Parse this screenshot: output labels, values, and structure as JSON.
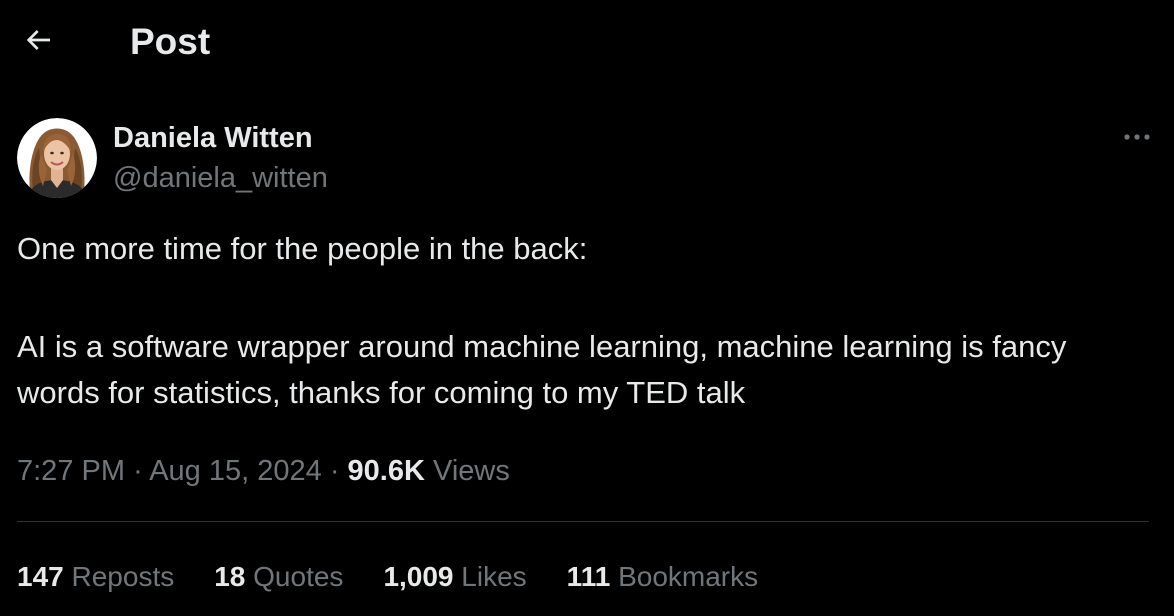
{
  "header": {
    "title": "Post",
    "back_icon": "arrow-left-icon"
  },
  "author": {
    "name": "Daniela Witten",
    "handle": "@daniela_witten",
    "avatar": "profile-photo"
  },
  "post": {
    "line1": "One more time for the people in the back:",
    "line2": "AI is a software wrapper around machine learning, machine learning is fancy words for statistics, thanks for coming to my TED talk"
  },
  "meta": {
    "time": "7:27 PM",
    "separator": "·",
    "date": "Aug 15, 2024",
    "views_count": "90.6K",
    "views_label": "Views"
  },
  "stats": [
    {
      "count": "147",
      "label": "Reposts"
    },
    {
      "count": "18",
      "label": "Quotes"
    },
    {
      "count": "1,009",
      "label": "Likes"
    },
    {
      "count": "111",
      "label": "Bookmarks"
    }
  ],
  "colors": {
    "background": "#000000",
    "text": "#e7e9ea",
    "secondary": "#71767b",
    "divider": "#2f3336"
  }
}
